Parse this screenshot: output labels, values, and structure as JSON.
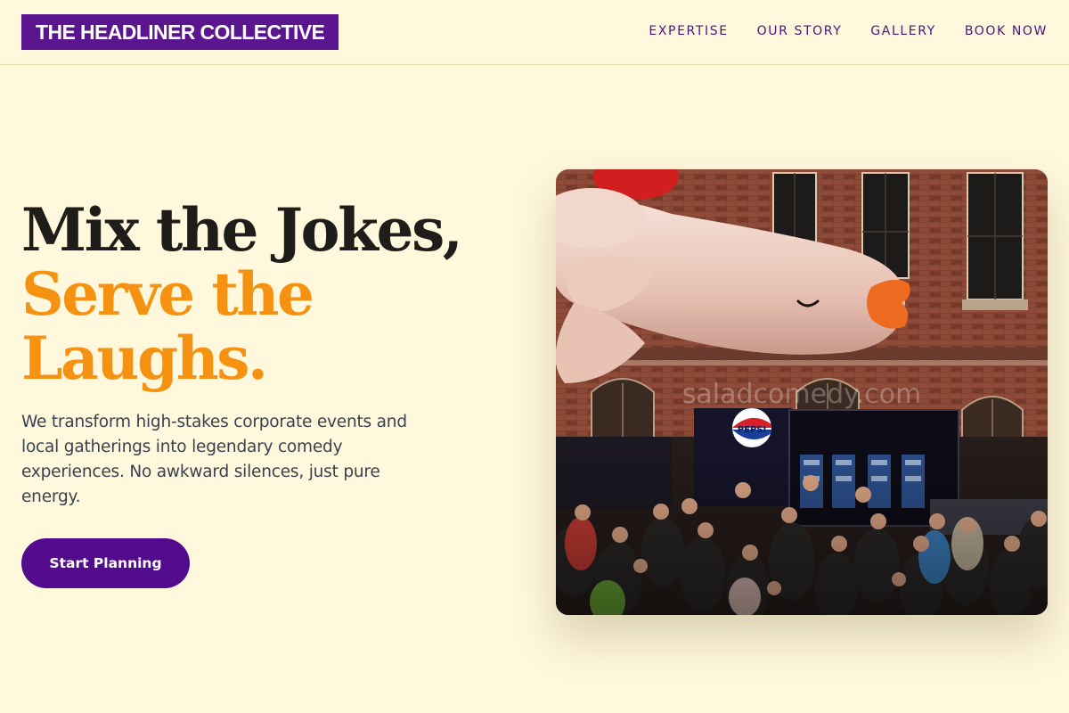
{
  "header": {
    "logo": "THE HEADLINER COLLECTIVE",
    "nav": [
      "EXPERTISE",
      "OUR STORY",
      "GALLERY",
      "BOOK NOW"
    ]
  },
  "hero": {
    "title_line1": "Mix the Jokes,",
    "title_line2": "Serve the",
    "title_line3": "Laughs.",
    "subtitle": "We transform high-stakes corporate events and local gatherings into legendary comedy experiences. No awkward silences, just pure energy.",
    "cta_label": "Start Planning"
  },
  "photo": {
    "banner_text": "PEPSI",
    "watermark": "saladcomedy.com"
  },
  "colors": {
    "background": "#fff8dc",
    "brand_purple": "#5b168f",
    "button_purple": "#520b8d",
    "accent_orange": "#f59212",
    "title_dark": "#1f1d1a"
  }
}
